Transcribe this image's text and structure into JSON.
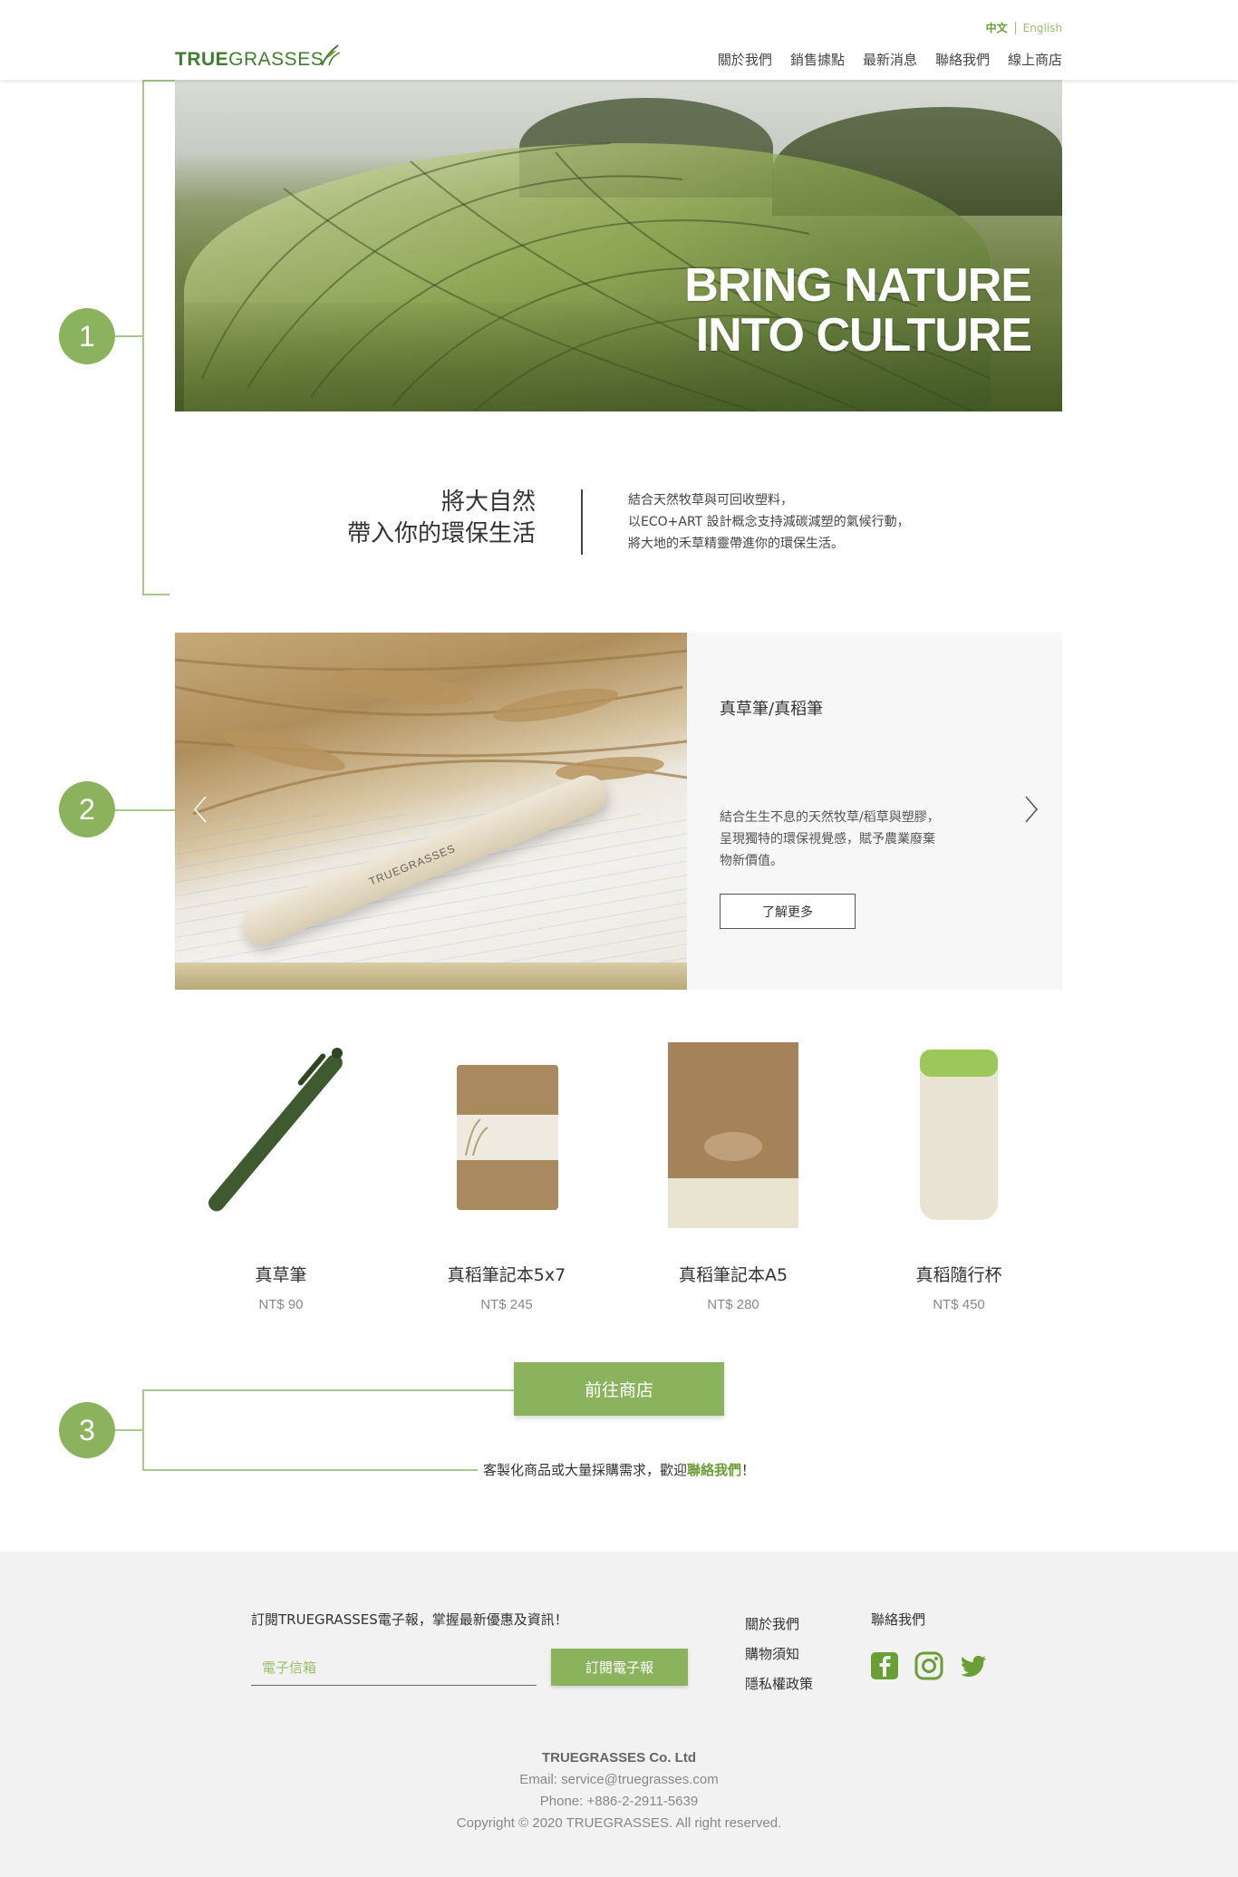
{
  "header": {
    "logo_true": "TRUE",
    "logo_grasses": "GRASSES",
    "lang_zh": "中文",
    "lang_en": "English",
    "nav": [
      "關於我們",
      "銷售據點",
      "最新消息",
      "聯絡我們",
      "線上商店"
    ]
  },
  "steps": [
    "1",
    "2",
    "3"
  ],
  "hero": {
    "line1": "BRING NATURE",
    "line2": "INTO CULTURE"
  },
  "intro": {
    "title_line1": "將大自然",
    "title_line2": "帶入你的環保生活",
    "desc": [
      "結合天然牧草與可回收塑料，",
      "以ECO+ART 設計概念支持減碳減塑的氣候行動，",
      "將大地的禾草精靈帶進你的環保生活。"
    ]
  },
  "feature": {
    "pen_label": "TRUEGRASSES",
    "title": "真草筆/真稻筆",
    "desc": [
      "結合生生不息的天然牧草/稻草與塑膠，",
      "呈現獨特的環保視覺感，賦予農業廢棄",
      "物新價值。"
    ],
    "more": "了解更多"
  },
  "products": [
    {
      "name": "真草筆",
      "price": "NT$ 90"
    },
    {
      "name": "真稻筆記本5x7",
      "price": "NT$ 245"
    },
    {
      "name": "真稻筆記本A5",
      "price": "NT$ 280"
    },
    {
      "name": "真稻隨行杯",
      "price": "NT$ 450"
    }
  ],
  "shop_button": "前往商店",
  "custom_note": {
    "before": "客製化商品或大量採購需求，歡迎",
    "link": "聯絡我們",
    "after": "！"
  },
  "footer": {
    "subscribe_text": "訂閱TRUEGRASSES電子報，掌握最新優惠及資訊！",
    "email_placeholder": "電子信箱",
    "subscribe_button": "訂閱電子報",
    "links": [
      "關於我們",
      "購物須知",
      "隱私權政策"
    ],
    "contact_title": "聯絡我們",
    "social_icons": [
      "facebook-icon",
      "instagram-icon",
      "twitter-icon"
    ],
    "company": "TRUEGRASSES Co. Ltd",
    "email": "Email: service@truegrasses.com",
    "phone": "Phone: +886-2-2911-5639",
    "copyright": "Copyright © 2020 TRUEGRASSES. All right reserved."
  },
  "colors": {
    "accent": "#8bb35e",
    "accent_dark": "#6a9e36",
    "logo": "#3f7f2a",
    "line": "#a9c98a"
  }
}
